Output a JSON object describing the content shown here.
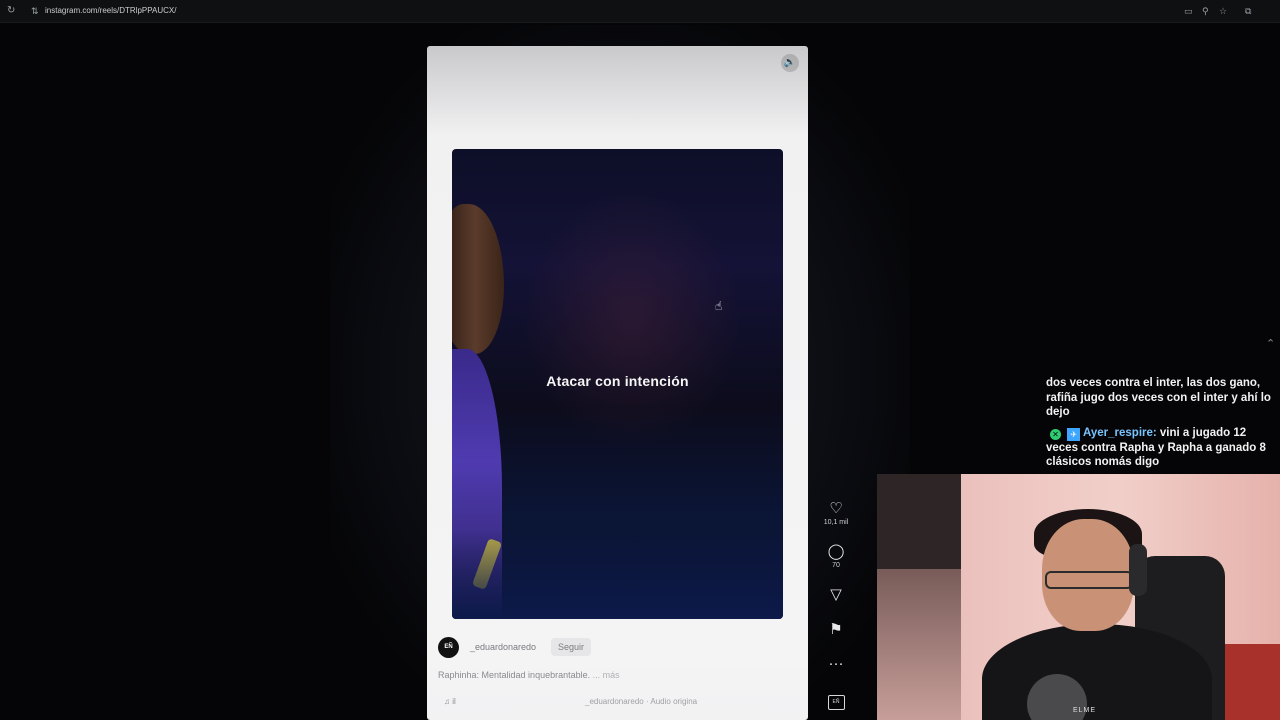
{
  "browser": {
    "url": "instagram.com/reels/DTRlpPPAUCX/"
  },
  "reel": {
    "overlay_text": "Atacar con intención",
    "author": "_eduardonaredo",
    "avatar_text": "EÑ",
    "follow_label": "Seguir",
    "description": "Raphinha: Mentalidad inquebrantable.",
    "more_label": "... más",
    "audio_note": "♫ il",
    "audio_source": "_eduardonaredo · Audio origina",
    "likes": "10,1 mil",
    "comments": "70"
  },
  "icons": {
    "like": "heart-icon",
    "comment": "comment-icon",
    "share": "send-icon",
    "save": "bookmark-icon",
    "more": "more-icon",
    "audio": "audio-thumbnail-icon",
    "volume": "volume-icon"
  },
  "chat": {
    "message1": "dos veces contra el inter, las dos gano, rafiña jugo dos veces con el inter y ahí lo dejo",
    "message2_user": "Ayer_respire:",
    "message2_text": " vini a jugado 12 veces contra Rapha y Rapha a ganado 8 clásicos nomás digo"
  },
  "webcam": {
    "shirt_text": "ELME"
  },
  "colors": {
    "chat_username": "#79c3ff",
    "background": "#050507"
  }
}
